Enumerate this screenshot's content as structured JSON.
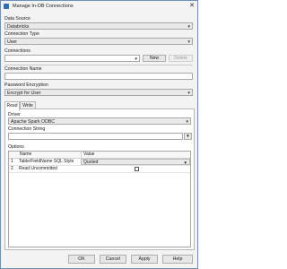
{
  "window": {
    "title": "Manage In-DB Connections"
  },
  "data_source": {
    "label": "Data Source",
    "value": "Databricks"
  },
  "connection_type": {
    "label": "Connection Type",
    "value": "User"
  },
  "connections": {
    "label": "Connections",
    "value": "",
    "new_label": "New",
    "delete_label": "Delete"
  },
  "connection_name": {
    "label": "Connection Name",
    "value": ""
  },
  "password_encryption": {
    "label": "Password Encryption",
    "value": "Encrypt for User"
  },
  "tabs": [
    {
      "label": "Read"
    },
    {
      "label": "Write"
    }
  ],
  "read": {
    "driver_label": "Driver",
    "driver_value": "Apache Spark ODBC",
    "connection_string_label": "Connection String",
    "connection_string_value": "",
    "options_label": "Options",
    "columns": [
      "Name",
      "Value"
    ],
    "rows": [
      {
        "num": "1",
        "name": "Table/FieldName SQL Style",
        "value": "Quoted",
        "type": "select"
      },
      {
        "num": "2",
        "name": "Read Uncommitted",
        "value": "",
        "type": "checkbox",
        "checked": false
      }
    ]
  },
  "buttons": {
    "ok": "OK",
    "cancel": "Cancel",
    "apply": "Apply",
    "help": "Help"
  }
}
